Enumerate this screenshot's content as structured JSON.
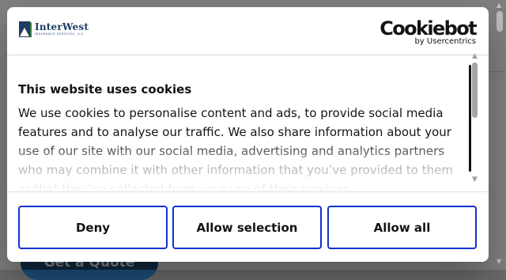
{
  "background_page": {
    "quote_button_label": "Get a Quote"
  },
  "header": {
    "brand_name": "InterWest",
    "brand_subtitle": "INSURANCE SERVICES, LLC",
    "cookiebot_name": "Cookiebot",
    "cookiebot_by": "by Usercentrics"
  },
  "body": {
    "title": "This website uses cookies",
    "text": "We use cookies to personalise content and ads, to provide social media features and to analyse our traffic. We also share information about your use of our site with our social media, advertising and analytics partners who may combine it with other information that you’ve provided to them or that they’ve collected from your use of their services."
  },
  "buttons": {
    "deny": "Deny",
    "allow_selection": "Allow selection",
    "allow_all": "Allow all"
  },
  "colors": {
    "button_border": "#1032cf",
    "brand_navy": "#1f3c63",
    "quote_button": "#1d4f7a"
  },
  "icons": {
    "brand_logo": "interwest-logo-icon",
    "scroll_up": "arrow-up-icon",
    "scroll_down": "arrow-down-icon"
  }
}
